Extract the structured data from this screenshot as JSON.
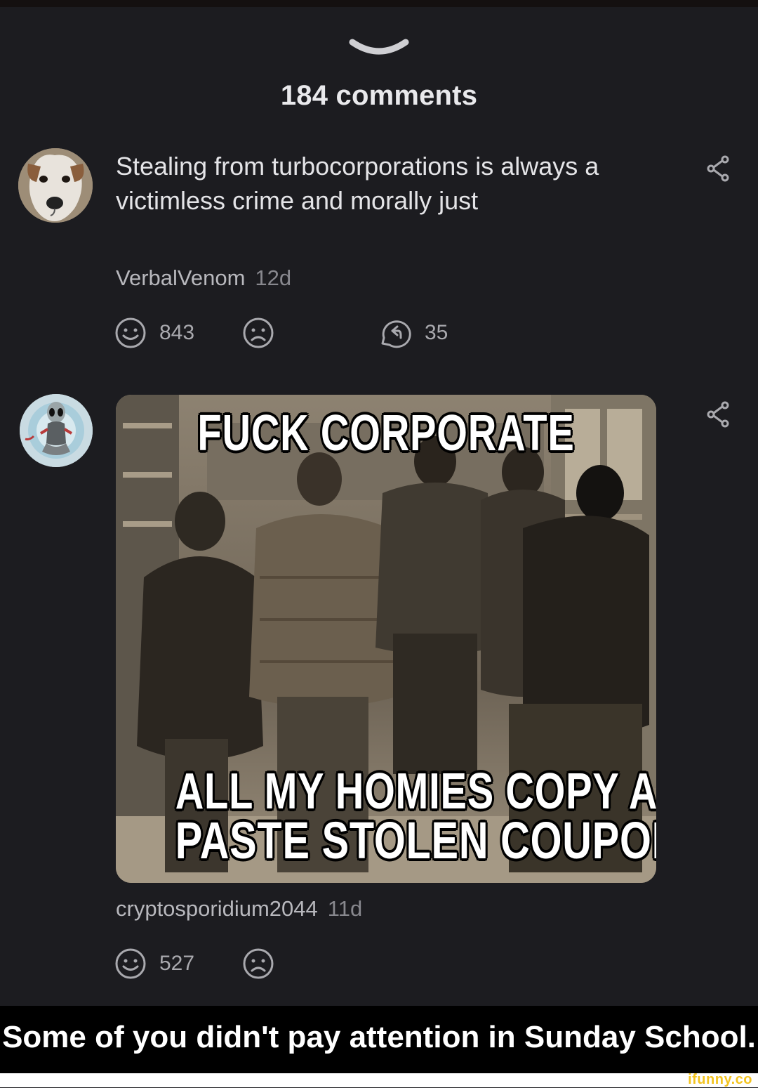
{
  "header": {
    "title": "184 comments"
  },
  "comments": [
    {
      "text": "Stealing from turbocorporations is always a victimless crime and morally just",
      "author": "VerbalVenom",
      "age": "12d",
      "smile_count": "843",
      "reply_count": "35",
      "avatar_icon": "dog-avatar-icon"
    },
    {
      "author": "cryptosporidium2044",
      "age": "11d",
      "smile_count": "527",
      "avatar_icon": "alien-avatar-icon",
      "meme": {
        "top_text": "FUCK CORPORATE",
        "bottom_line1": "ALL MY HOMIES COPY AND",
        "bottom_line2": "PASTE STOLEN COUPON CODES"
      }
    }
  ],
  "caption": "Some of you didn't pay attention in Sunday School.",
  "watermark": "ifunny.co",
  "colors": {
    "background": "#1c1c20",
    "text": "#e4e4e7",
    "muted": "#88888e",
    "watermark": "#f3c420"
  }
}
